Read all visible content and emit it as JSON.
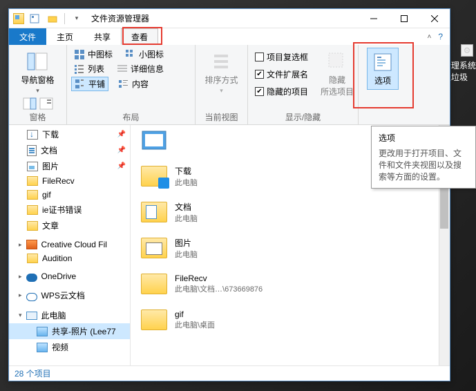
{
  "window": {
    "title": "文件资源管理器"
  },
  "tabs": {
    "file": "文件",
    "home": "主页",
    "share": "共享",
    "view": "查看"
  },
  "ribbon": {
    "pane_group": "窗格",
    "nav_pane": "导航窗格",
    "layout_group": "布局",
    "medium_icons": "中图标",
    "small_icons": "小图标",
    "list": "列表",
    "details": "详细信息",
    "tiles": "平铺",
    "content": "内容",
    "current_view_group": "当前视图",
    "sort": "排序方式",
    "show_hide_group": "显示/隐藏",
    "item_checkboxes": "项目复选框",
    "file_ext": "文件扩展名",
    "hidden_items": "隐藏的项目",
    "hide_selected": "隐藏\n所选项目",
    "options": "选项"
  },
  "tooltip": {
    "title": "选项",
    "body": "更改用于打开项目、文件和文件夹视图以及搜索等方面的设置。"
  },
  "nav": {
    "downloads": "下载",
    "documents": "文档",
    "pictures": "图片",
    "filerecv": "FileRecv",
    "gif": "gif",
    "ie_error": "ie证书错误",
    "articles": "文章",
    "ccf": "Creative Cloud Fil",
    "audition": "Audition",
    "onedrive": "OneDrive",
    "wps": "WPS云文档",
    "thispc": "此电脑",
    "share_photos": "共享-照片 (Lee77",
    "video": "视频"
  },
  "files": [
    {
      "name": "下载",
      "sub": "此电脑",
      "icon": "dl"
    },
    {
      "name": "文档",
      "sub": "此电脑",
      "icon": "doc"
    },
    {
      "name": "图片",
      "sub": "此电脑",
      "icon": "pic"
    },
    {
      "name": "FileRecv",
      "sub": "此电脑\\文档…\\673669876",
      "icon": "plain"
    },
    {
      "name": "gif",
      "sub": "此电脑\\桌面",
      "icon": "plain"
    }
  ],
  "status": "28 个项目",
  "desktop": {
    "line1": "清理系统",
    "line2": "表垃圾"
  }
}
